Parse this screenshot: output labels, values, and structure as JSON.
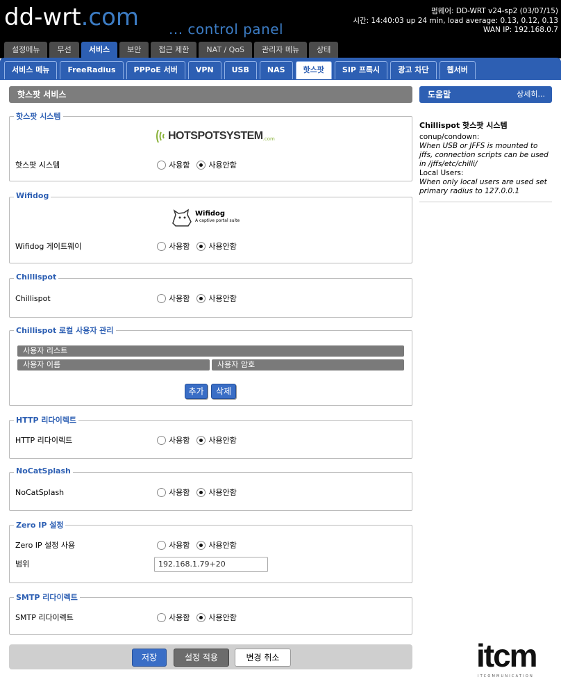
{
  "header": {
    "logo_text": "dd-wrt",
    "logo_suffix": ".com",
    "control_panel": "... control panel",
    "firmware": "펌웨어: DD-WRT v24-sp2 (03/07/15)",
    "uptime": "시간: 14:40:03 up 24 min, load average: 0.13, 0.12, 0.13",
    "wan_ip": "WAN IP: 192.168.0.7"
  },
  "top_tabs": [
    {
      "label": "설정메뉴",
      "active": false
    },
    {
      "label": "무선",
      "active": false
    },
    {
      "label": "서비스",
      "active": true
    },
    {
      "label": "보안",
      "active": false
    },
    {
      "label": "접근 제한",
      "active": false
    },
    {
      "label": "NAT / QoS",
      "active": false
    },
    {
      "label": "관리자 메뉴",
      "active": false
    },
    {
      "label": "상태",
      "active": false
    }
  ],
  "sub_tabs": [
    {
      "label": "서비스 메뉴",
      "active": false
    },
    {
      "label": "FreeRadius",
      "active": false
    },
    {
      "label": "PPPoE 서버",
      "active": false
    },
    {
      "label": "VPN",
      "active": false
    },
    {
      "label": "USB",
      "active": false
    },
    {
      "label": "NAS",
      "active": false
    },
    {
      "label": "핫스팟",
      "active": true
    },
    {
      "label": "SIP 프록시",
      "active": false
    },
    {
      "label": "광고 차단",
      "active": false
    },
    {
      "label": "웹서버",
      "active": false
    }
  ],
  "main": {
    "title": "핫스팟 서비스",
    "radio_on": "사용함",
    "radio_off": "사용안함",
    "hotspot": {
      "legend": "핫스팟 시스템",
      "logo_text": "HOTSPOTSYSTEM",
      "logo_suffix": ".com",
      "label": "핫스팟 시스템",
      "enabled": false
    },
    "wifidog": {
      "legend": "Wifidog",
      "logo_text": "Wifidog",
      "logo_tagline": "A captive portal suite",
      "label": "Wifidog 게이트웨이",
      "enabled": false
    },
    "chillispot": {
      "legend": "Chillispot",
      "label": "Chillispot",
      "enabled": false
    },
    "local_users": {
      "legend": "Chillispot 로컬 사용자 관리",
      "list_header": "사용자 리스트",
      "col_user": "사용자 이름",
      "col_pass": "사용자 암호",
      "add": "추가",
      "remove": "삭제"
    },
    "http_redirect": {
      "legend": "HTTP 리다이렉트",
      "label": "HTTP 리다이렉트",
      "enabled": false
    },
    "nocat": {
      "legend": "NoCatSplash",
      "label": "NoCatSplash",
      "enabled": false
    },
    "zeroip": {
      "legend": "Zero IP 설정",
      "label": "Zero IP 설정 사용",
      "enabled": false,
      "range_label": "범위",
      "range_value": "192.168.1.79+20"
    },
    "smtp": {
      "legend": "SMTP 리다이렉트",
      "label": "SMTP 리다이렉트",
      "enabled": false
    },
    "footer": {
      "save": "저장",
      "apply": "설정 적용",
      "cancel": "변경 취소"
    }
  },
  "help": {
    "title": "도움말",
    "more": "상세히...",
    "heading": "Chillispot 핫스팟 시스템",
    "l1": "conup/condown:",
    "l2": "When USB or JFFS is mounted to jffs, connection scripts can be used in /jffs/etc/chilli/",
    "l3": "Local Users:",
    "l4": "When only local users are used set primary radius to 127.0.0.1"
  },
  "brand": {
    "name": "itcm",
    "sub": "ITCOMMUNICATION"
  },
  "colors": {
    "accent": "#2d5fb3",
    "header_bg": "#000000",
    "section_bar": "#7d7d7d"
  }
}
